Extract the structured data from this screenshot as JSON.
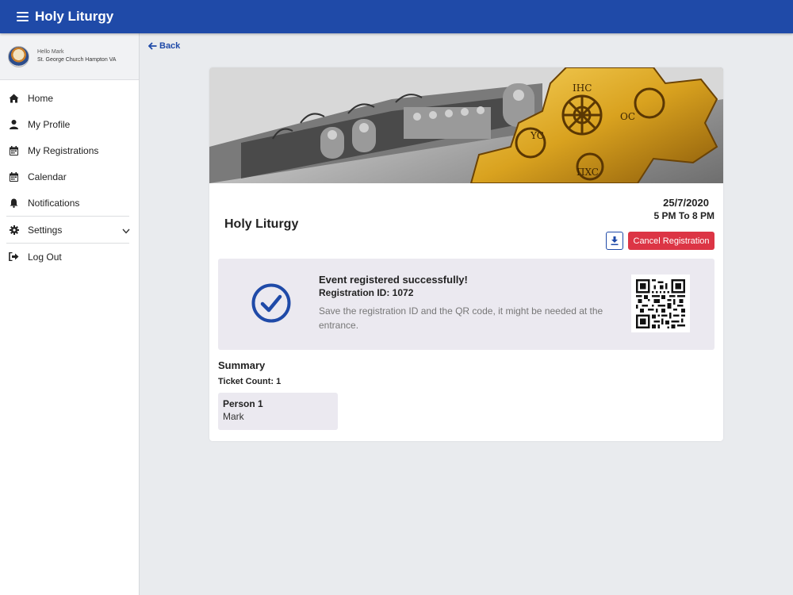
{
  "app": {
    "title": "Holy Liturgy"
  },
  "profile": {
    "greeting": "Hello Mark",
    "church": "St. George Church Hampton VA"
  },
  "sidebar": {
    "items": [
      {
        "label": "Home",
        "icon": "home-icon"
      },
      {
        "label": "My Profile",
        "icon": "user-icon"
      },
      {
        "label": "My Registrations",
        "icon": "calendar-icon"
      },
      {
        "label": "Calendar",
        "icon": "calendar-icon"
      },
      {
        "label": "Notifications",
        "icon": "bell-icon"
      },
      {
        "label": "Settings",
        "icon": "gear-icon"
      },
      {
        "label": "Log Out",
        "icon": "logout-icon"
      }
    ]
  },
  "back": {
    "label": "Back"
  },
  "event": {
    "title": "Holy Liturgy",
    "date": "25/7/2020",
    "time": "5 PM To 8 PM",
    "cancel_label": "Cancel Registration"
  },
  "registration": {
    "success_title": "Event registered successfully!",
    "id_text": "Registration ID: 1072",
    "note": "Save the registration ID and the QR code, it might be needed at the entrance."
  },
  "summary": {
    "title": "Summary",
    "ticket_count": "Ticket Count: 1",
    "persons": [
      {
        "label": "Person 1",
        "name": "Mark"
      }
    ]
  },
  "colors": {
    "primary": "#1f4aa8",
    "danger": "#dc3545",
    "panel": "#ebe9f0",
    "background": "#e9ebee"
  }
}
